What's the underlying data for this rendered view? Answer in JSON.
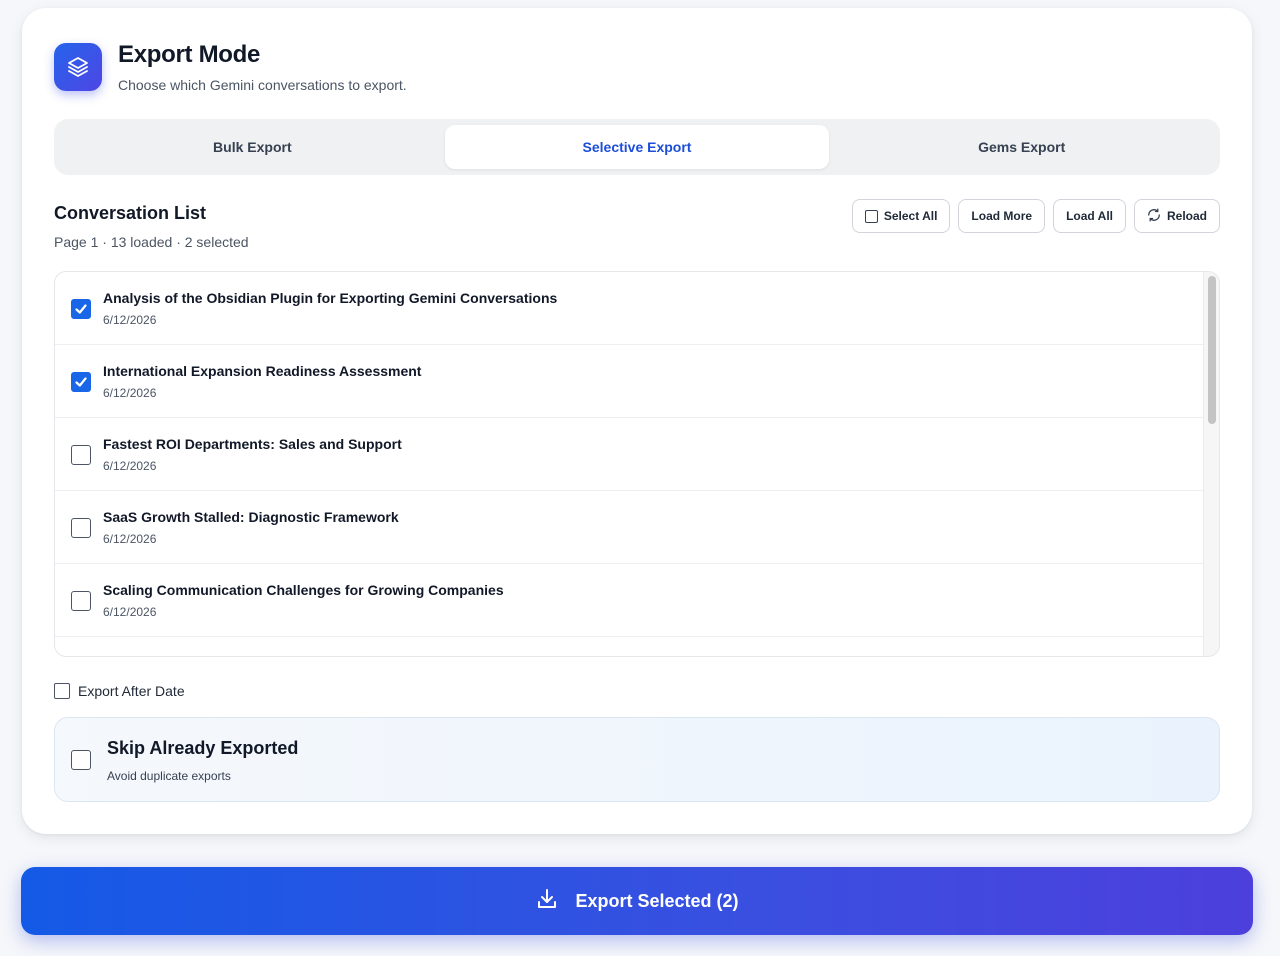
{
  "header": {
    "title": "Export Mode",
    "subtitle": "Choose which Gemini conversations to export."
  },
  "tabs": [
    {
      "label": "Bulk Export",
      "active": false
    },
    {
      "label": "Selective Export",
      "active": true
    },
    {
      "label": "Gems Export",
      "active": false
    }
  ],
  "conversation_list": {
    "title": "Conversation List",
    "meta": "Page 1 · 13 loaded · 2 selected",
    "actions": {
      "select_all": "Select All",
      "load_more": "Load More",
      "load_all": "Load All",
      "reload": "Reload"
    },
    "items": [
      {
        "title": "Analysis of the Obsidian Plugin for Exporting Gemini Conversations",
        "date": "6/12/2026",
        "checked": true
      },
      {
        "title": "International Expansion Readiness Assessment",
        "date": "6/12/2026",
        "checked": true
      },
      {
        "title": "Fastest ROI Departments: Sales and Support",
        "date": "6/12/2026",
        "checked": false
      },
      {
        "title": "SaaS Growth Stalled: Diagnostic Framework",
        "date": "6/12/2026",
        "checked": false
      },
      {
        "title": "Scaling Communication Challenges for Growing Companies",
        "date": "6/12/2026",
        "checked": false
      }
    ]
  },
  "options": {
    "export_after_date": {
      "label": "Export After Date",
      "checked": false
    },
    "skip_exported": {
      "title": "Skip Already Exported",
      "subtitle": "Avoid duplicate exports",
      "checked": false
    }
  },
  "export_button": {
    "label": "Export Selected (2)"
  },
  "colors": {
    "accent": "#1a66e8",
    "active_tab_text": "#1d4ed8",
    "button_gradient_start": "#145ae6",
    "button_gradient_end": "#4d3fdc"
  }
}
